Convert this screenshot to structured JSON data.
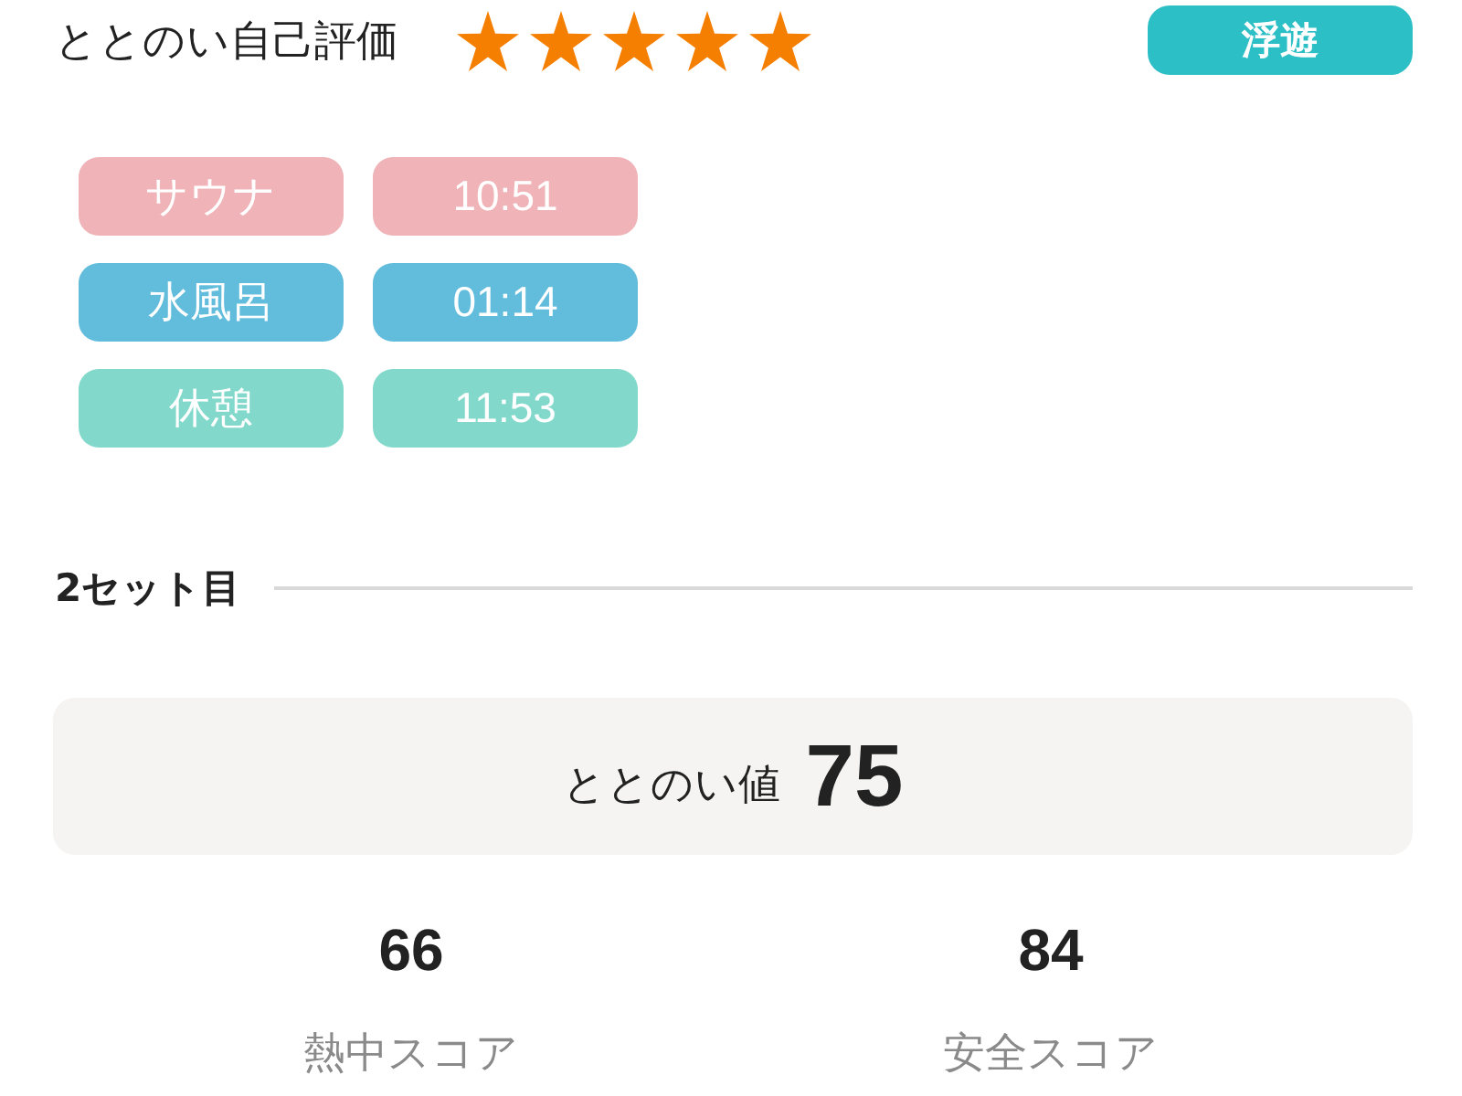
{
  "rating": {
    "label": "ととのい自己評価",
    "stars": 5
  },
  "badge": {
    "label": "浮遊"
  },
  "phases": [
    {
      "name": "サウナ",
      "time": "10:51",
      "color": "#efb3b8"
    },
    {
      "name": "水風呂",
      "time": "01:14",
      "color": "#62bcdc"
    },
    {
      "name": "休憩",
      "time": "11:53",
      "color": "#82d9cb"
    }
  ],
  "set": {
    "title": "2セット目"
  },
  "score_card": {
    "label": "ととのい値",
    "value": "75"
  },
  "scores": [
    {
      "value": "66",
      "label": "熱中スコア"
    },
    {
      "value": "84",
      "label": "安全スコア"
    }
  ]
}
